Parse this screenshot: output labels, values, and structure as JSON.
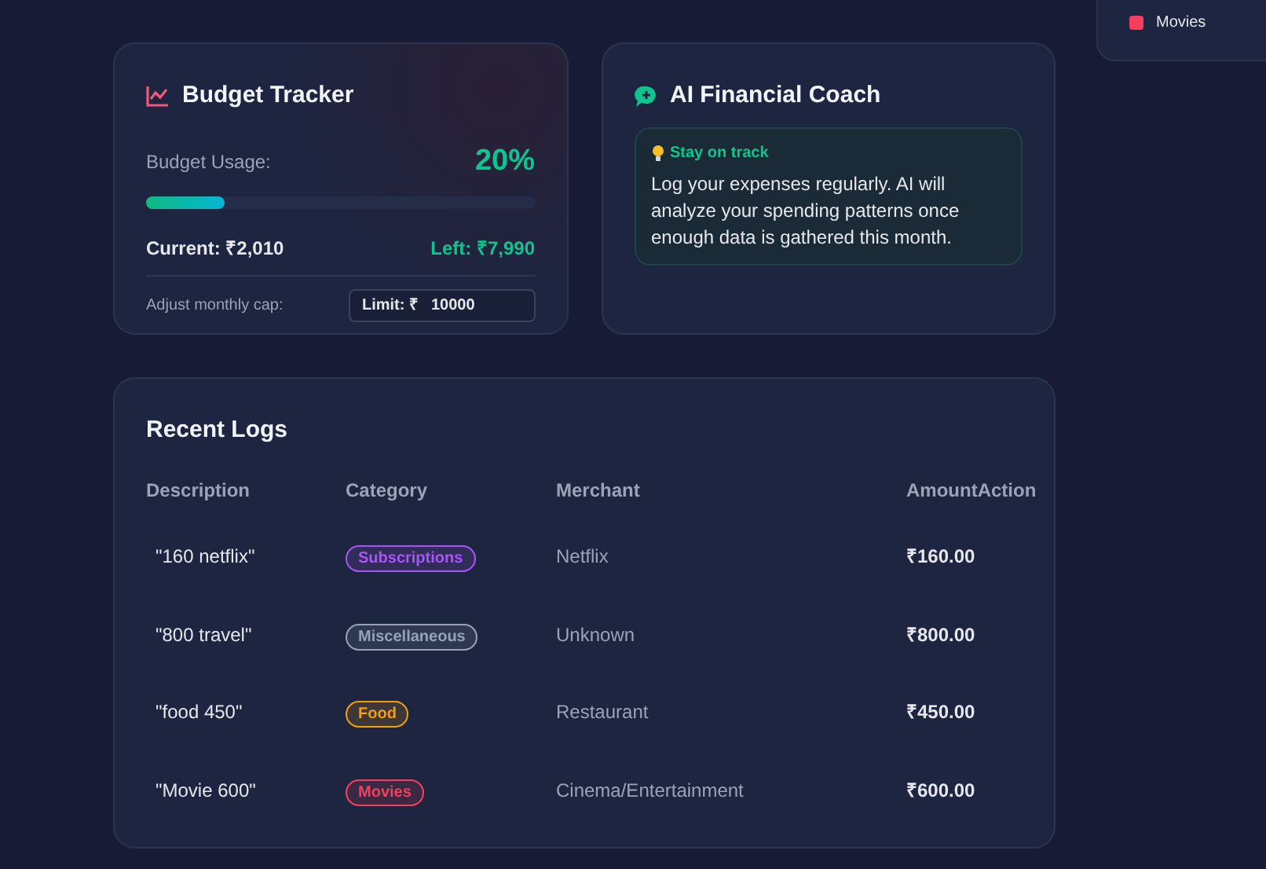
{
  "legend": {
    "items": [
      {
        "label": "Movies",
        "color": "#f43f5e"
      }
    ]
  },
  "budget": {
    "title": "Budget Tracker",
    "usage_label": "Budget Usage:",
    "percent": "20%",
    "level": 0.2,
    "current": "Current: ₹2,010",
    "left": "Left: ₹7,990",
    "cap_label": "Adjust monthly cap:",
    "limit_prefix": "Limit: ₹",
    "limit_value": "10000"
  },
  "coach": {
    "title": "AI Financial Coach",
    "tip_title": "Stay on track",
    "tip_text": "Log your expenses regularly. AI will analyze your spending patterns once enough data is gathered this month."
  },
  "logs": {
    "title": "Recent Logs",
    "columns": [
      "Description",
      "Category",
      "Merchant",
      "Amount",
      "Action"
    ],
    "rows": [
      {
        "description": "\"160 netflix\"",
        "category": "Subscriptions",
        "color": "#a855f7",
        "merchant": "Netflix",
        "amount": "₹160.00"
      },
      {
        "description": "\"800 travel\"",
        "category": "Miscellaneous",
        "color": "#94a3b8",
        "merchant": "Unknown",
        "amount": "₹800.00"
      },
      {
        "description": "\"food 450\"",
        "category": "Food",
        "color": "#f59e0b",
        "merchant": "Restaurant",
        "amount": "₹450.00"
      },
      {
        "description": "\"Movie 600\"",
        "category": "Movies",
        "color": "#f43f5e",
        "merchant": "Cinema/Entertainment",
        "amount": "₹600.00"
      }
    ]
  }
}
